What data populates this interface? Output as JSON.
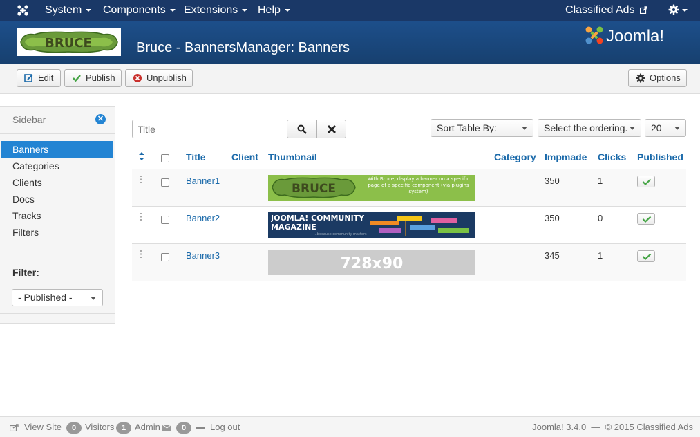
{
  "topnav": {
    "menus": [
      "System",
      "Components",
      "Extensions",
      "Help"
    ],
    "site_link": "Classified Ads"
  },
  "header": {
    "page_title": "Bruce - BannersManager: Banners",
    "brand_logo_text": "BRUCE",
    "joomla_logo_text": "Joomla!"
  },
  "toolbar": {
    "edit": "Edit",
    "publish": "Publish",
    "unpublish": "Unpublish",
    "options": "Options"
  },
  "sidebar": {
    "heading": "Sidebar",
    "items": [
      "Banners",
      "Categories",
      "Clients",
      "Docs",
      "Tracks",
      "Filters"
    ],
    "active": "Banners",
    "filter_label": "Filter:",
    "filter_value": "- Published -"
  },
  "search": {
    "placeholder": "Title",
    "sort_label": "Sort Table By:",
    "ordering_label": "Select the ordering.",
    "limit": "20"
  },
  "table": {
    "columns": [
      "Title",
      "Client",
      "Thumbnail",
      "Category",
      "Impmade",
      "Clicks",
      "Published"
    ],
    "rows": [
      {
        "title": "Banner1",
        "impmade": "350",
        "clicks": "1",
        "thumb_text": "BRUCE",
        "thumb_caption": "With Bruce, display a banner on a specific page of a specific component (via plugins system)"
      },
      {
        "title": "Banner2",
        "impmade": "350",
        "clicks": "0",
        "thumb_text": "JOOMLA! COMMUNITY MAGAZINE",
        "thumb_caption": "...because community matters"
      },
      {
        "title": "Banner3",
        "impmade": "345",
        "clicks": "1",
        "thumb_text": "728x90",
        "thumb_caption": ""
      }
    ]
  },
  "footer": {
    "view_site": "View Site",
    "visitors_count": "0",
    "visitors_label": "Visitors",
    "admin_count": "1",
    "admin_label": "Admin",
    "messages_count": "0",
    "logout": "Log out",
    "version": "Joomla! 3.4.0  —  © 2015 Classified Ads"
  },
  "colors": {
    "navbar": "#1a3867",
    "header": "#1d4f8b",
    "accent": "#2384d3",
    "link": "#1b6aaa",
    "publish_check": "#46a546",
    "unpublish_icon": "#c9302c"
  }
}
